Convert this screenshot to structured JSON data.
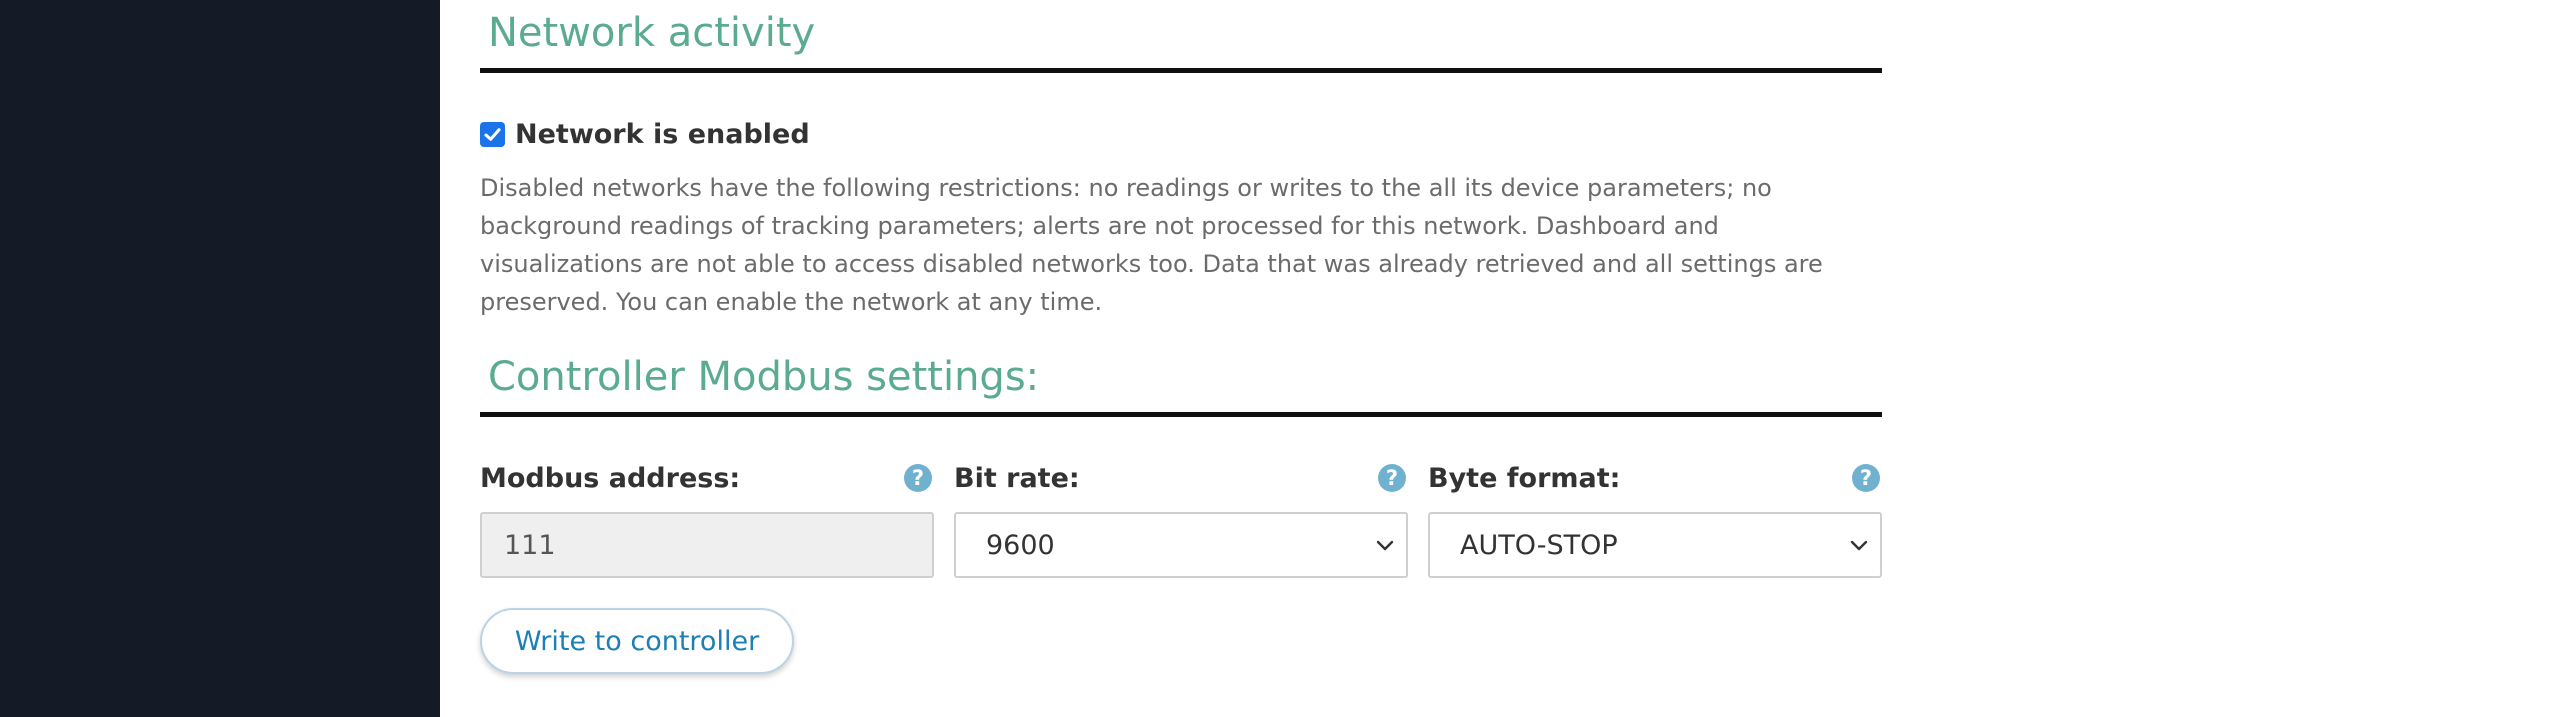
{
  "network_activity": {
    "title": "Network activity",
    "enabled_label": "Network is enabled",
    "enabled_checked": true,
    "description": "Disabled networks have the following restrictions: no readings or writes to the all its device parameters; no background readings of tracking parameters; alerts are not processed for this network. Dashboard and visualizations are not able to access disabled networks too. Data that was already retrieved and all settings are preserved. You can enable the network at any time."
  },
  "modbus": {
    "title": "Controller Modbus settings:",
    "fields": {
      "address": {
        "label": "Modbus address:",
        "value": "111",
        "help_icon": "?"
      },
      "bit_rate": {
        "label": "Bit rate:",
        "value": "9600",
        "help_icon": "?"
      },
      "byte_format": {
        "label": "Byte format:",
        "value": "AUTO-STOP",
        "help_icon": "?"
      }
    },
    "write_button_label": "Write to controller"
  },
  "colors": {
    "sidebar": "#151b26",
    "heading": "#5aab8f",
    "link": "#1c7fb5",
    "checkbox": "#1a73e8",
    "help_icon": "#6fb1cf"
  }
}
